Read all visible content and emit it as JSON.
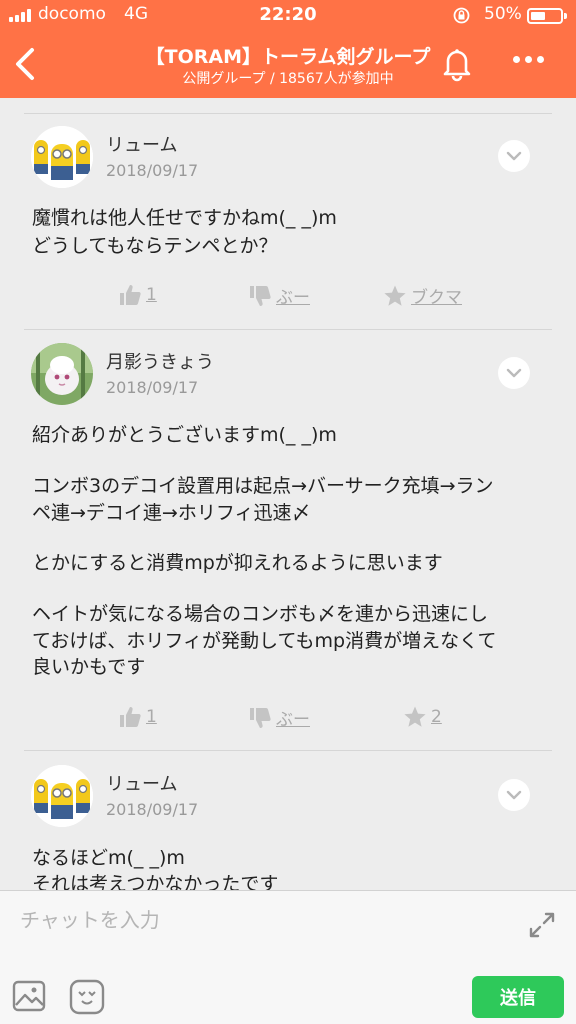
{
  "status_bar": {
    "carrier": "docomo",
    "network": "4G",
    "time": "22:20",
    "battery_percent": "50%",
    "battery_level": 0.5
  },
  "header": {
    "title": "【TORAM】トーラム剣グループ",
    "subtitle": "公開グループ / 18567人が参加中",
    "back_icon": "chevron-left-icon",
    "bell_icon": "bell-icon",
    "more_icon": "more-dots-icon"
  },
  "posts": [
    {
      "username": "リューム",
      "date": "2018/09/17",
      "avatar": "minion-avatar",
      "lines": [
        "魔慣れは他人任せですかねm(_ _)m",
        "どうしてもならテンペとか？"
      ],
      "likes": "1",
      "boo": "ぶー",
      "bookmark": "ブクマ"
    },
    {
      "username": "月影うきょう",
      "date": "2018/09/17",
      "avatar": "white-fluffy-avatar",
      "lines": [
        "紹介ありがとうございますm(_ _)m",
        "",
        "コンボ3のデコイ設置用は起点→バーサーク充填→ラン",
        "ペ連→デコイ連→ホリフィ迅速〆",
        "",
        "とかにすると消費mpが抑えれるように思います",
        "",
        "ヘイトが気になる場合のコンボも〆を連から迅速にし",
        "ておけば、ホリフィが発動してもmp消費が増えなくて",
        "良いかもです"
      ],
      "likes": "1",
      "boo": "ぶー",
      "bookmark": "2"
    },
    {
      "username": "リューム",
      "date": "2018/09/17",
      "avatar": "minion-avatar",
      "lines": [
        "なるほどm(_ _)m",
        "それは考えつかなかったです"
      ]
    }
  ],
  "composer": {
    "placeholder": "チャットを入力",
    "send_label": "送信"
  },
  "colors": {
    "header_bg": "#ff7246",
    "send_bg": "#2ec95a",
    "page_bg": "#ededed"
  }
}
